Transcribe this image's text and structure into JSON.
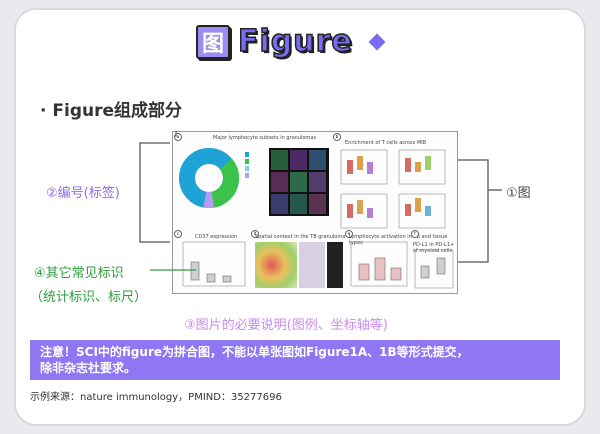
{
  "title": {
    "badge": "图",
    "text": "Figure"
  },
  "subtitle": "· Figure组成部分",
  "annotations": {
    "figure": "①图",
    "number": "②编号(标签)",
    "legend": "③图片的必要说明(图例、坐标轴等)",
    "other_line1": "④其它常见标识",
    "other_line2": "（统计标识、标尺）"
  },
  "figure_labels": {
    "panel_a_title": "Major lymphocyte subsets in granulomas",
    "panel_b_title": "Enrichment of T cells across MIB",
    "panel_c_title": "CD37 expression",
    "panel_d_title": "Spatial context in the TB granuloma",
    "panel_e_title": "Lymphocyte activation in TB and tissue types",
    "panel_f_title": "PD-L1 in PD-L1+ of myeloid cells",
    "panel_nums": [
      "a",
      "b",
      "c",
      "d",
      "e",
      "f"
    ]
  },
  "note": {
    "line1": "注意！SCI中的figure为拼合图，不能以单张图如Figure1A、1B等形式提交，",
    "line2": "除非杂志社要求。"
  },
  "source": "示例来源：nature immunology，PMIND：35277696",
  "colors": {
    "accent": "#8f76f3",
    "green": "#2e9e3a",
    "pie_blue": "#1fa3d6",
    "pie_green": "#3bc24a"
  }
}
